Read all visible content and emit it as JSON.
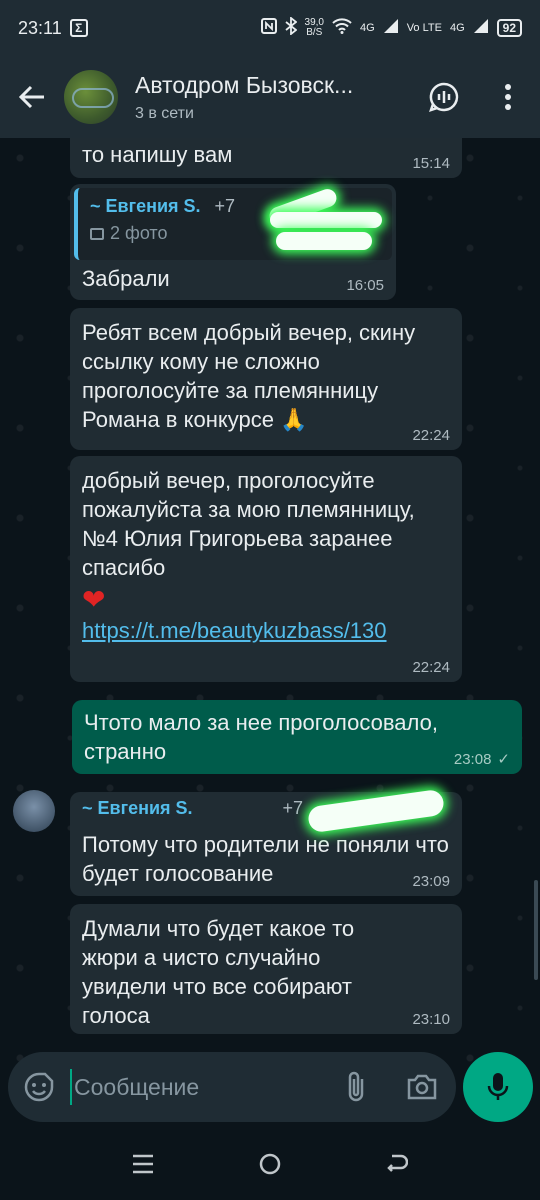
{
  "status_bar": {
    "time": "23:11",
    "s_badge": "Σ",
    "speed_top": "39,0",
    "speed_bottom": "B/S",
    "net1": "4G",
    "volte": "Vo LTE",
    "net2": "4G",
    "battery": "92"
  },
  "header": {
    "title": "Автодром Бызовск...",
    "subtitle": "3 в сети"
  },
  "messages": {
    "m1": {
      "text": "то напишу вам",
      "time": "15:14"
    },
    "m2": {
      "quote_name": "~ Евгения S.",
      "quote_phone": "+7",
      "quote_sub": "2 фото",
      "text": "Забрали",
      "time": "16:05"
    },
    "m3": {
      "text": "Ребят всем добрый вечер, скину ссылку кому не сложно проголосуйте за племянницу Романа в конкурсе 🙏",
      "time": "22:24"
    },
    "m4": {
      "text": "добрый вечер, проголосуйте пожалуйста за мою племянницу, №4 Юлия Григорьева заранее спасибо",
      "heart": "❤",
      "link": "https://t.me/beautykuzbass/130",
      "time": "22:24"
    },
    "m5": {
      "text": "Чтото мало за нее проголосовало, странно",
      "time": "23:08",
      "check": "✓"
    },
    "m6": {
      "quote_name": "~ Евгения S.",
      "quote_phone": "+7",
      "text": "Потому что родители не поняли что будет голосование",
      "time": "23:09"
    },
    "m7": {
      "text": "Думали что будет какое то жюри а чисто случайно увидели что все собирают голоса",
      "time": "23:10"
    }
  },
  "input": {
    "placeholder": "Сообщение"
  },
  "colors": {
    "background": "#0b141a",
    "bubble_in": "#202c33",
    "bubble_out": "#005c4b",
    "accent": "#00a884",
    "link": "#53bdeb"
  }
}
